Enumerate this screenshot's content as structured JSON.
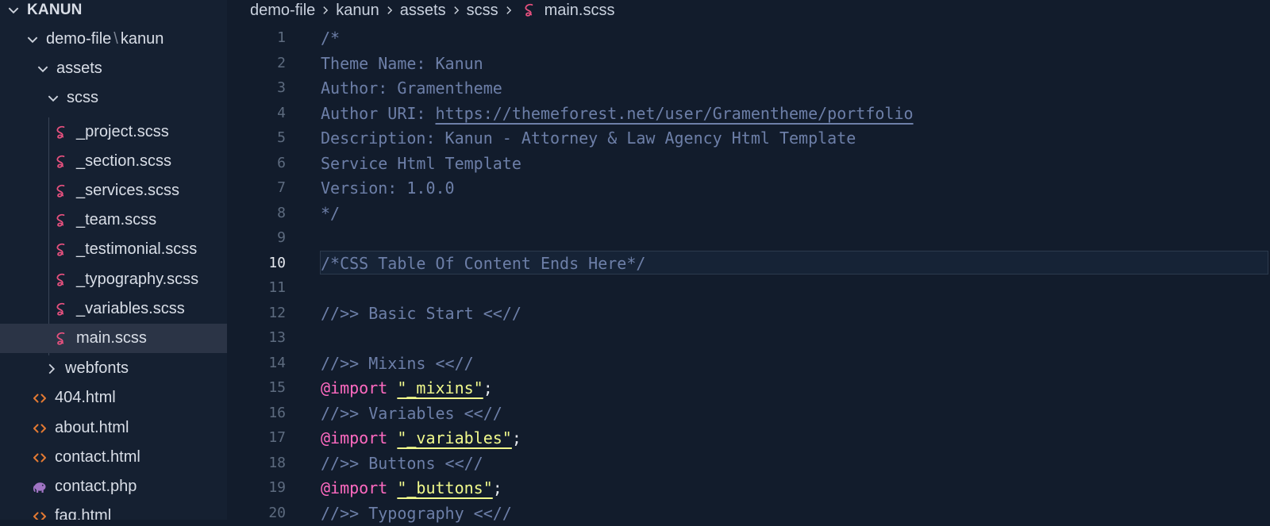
{
  "explorer": {
    "root": "KANUN",
    "folder_path": {
      "a": "demo-file",
      "sep": "\\",
      "b": "kanun"
    },
    "items": {
      "assets": "assets",
      "scss": "scss",
      "f1": "_project.scss",
      "f2": "_section.scss",
      "f3": "_services.scss",
      "f4": "_team.scss",
      "f5": "_testimonial.scss",
      "f6": "_typography.scss",
      "f7": "_variables.scss",
      "f8": "main.scss",
      "webfonts": "webfonts",
      "h1": "404.html",
      "h2": "about.html",
      "h3": "contact.html",
      "p1": "contact.php",
      "h4": "faq.html"
    }
  },
  "breadcrumb": {
    "b1": "demo-file",
    "b2": "kanun",
    "b3": "assets",
    "b4": "scss",
    "b5": "main.scss"
  },
  "editor": {
    "current_line": 10,
    "lines": [
      {
        "n": "1",
        "t": "/*"
      },
      {
        "n": "2",
        "t": "Theme Name: Kanun"
      },
      {
        "n": "3",
        "t": "Author: Gramentheme"
      },
      {
        "n": "4",
        "t": "Author URI: ",
        "link": "https://themeforest.net/user/Gramentheme/portfolio"
      },
      {
        "n": "5",
        "t": "Description: Kanun - Attorney & Law Agency Html Template"
      },
      {
        "n": "6",
        "t": "Service Html Template"
      },
      {
        "n": "7",
        "t": "Version: 1.0.0"
      },
      {
        "n": "8",
        "t": "*/"
      },
      {
        "n": "9",
        "t": ""
      },
      {
        "n": "10",
        "t": "/*CSS Table Of Content Ends Here*/"
      },
      {
        "n": "11",
        "t": ""
      },
      {
        "n": "12",
        "t": "//>> Basic Start <<//"
      },
      {
        "n": "13",
        "t": ""
      },
      {
        "n": "14",
        "t": "//>> Mixins <<//"
      },
      {
        "n": "15",
        "kw": "@import",
        "str": "\"_mixins\"",
        "p": ";"
      },
      {
        "n": "16",
        "t": "//>> Variables <<//"
      },
      {
        "n": "17",
        "kw": "@import",
        "str": "\"_variables\"",
        "p": ";"
      },
      {
        "n": "18",
        "t": "//>> Buttons <<//"
      },
      {
        "n": "19",
        "kw": "@import",
        "str": "\"_buttons\"",
        "p": ";"
      },
      {
        "n": "20",
        "t": "//>> Typography <<//"
      }
    ]
  },
  "colors": {
    "background": "#121c2c",
    "sidebar": "#152031",
    "selection": "#2b3446",
    "sass_icon": "#e8517f",
    "html_icon": "#e37933",
    "php_icon": "#a074c4",
    "keyword": "#ff6ac1",
    "string": "#f1fa8c",
    "comment": "#6d7fa8"
  },
  "icons": {
    "chevron_down": "chevron-down-icon",
    "chevron_right": "chevron-right-icon",
    "sass": "sass-file-icon",
    "html": "html-file-icon",
    "php": "php-file-icon"
  }
}
